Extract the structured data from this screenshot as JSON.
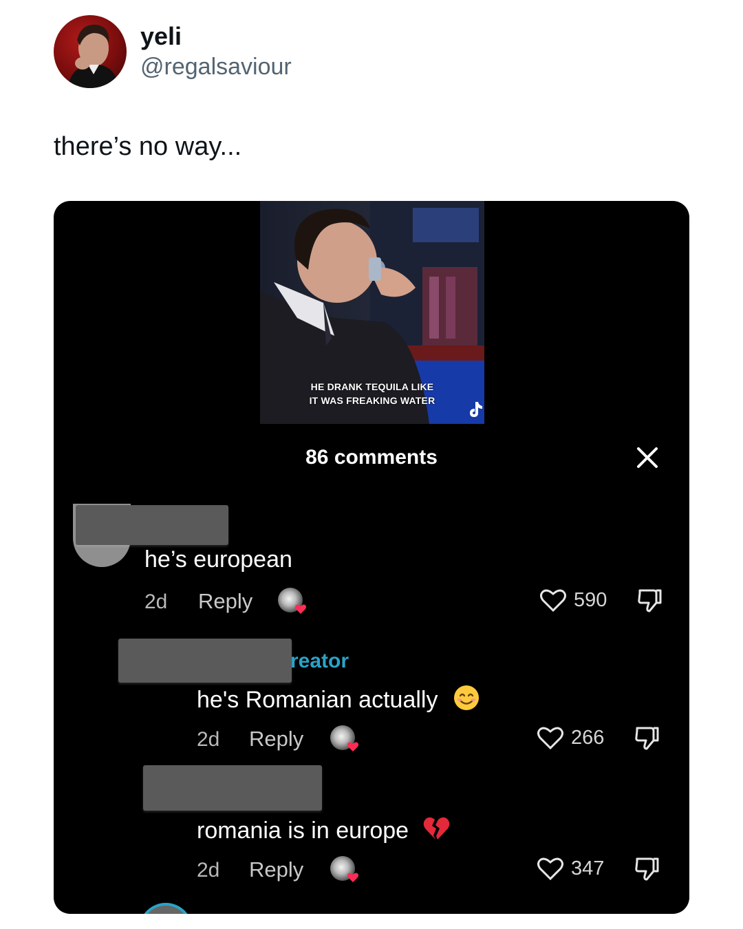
{
  "tweet": {
    "display_name": "yeli",
    "handle": "@regalsaviour",
    "text": "there’s no way..."
  },
  "video": {
    "caption_line1": "HE DRANK TEQUILA LIKE",
    "caption_line2": "IT WAS FREAKING WATER",
    "watermark": "TikTok"
  },
  "comments_panel": {
    "title": "86 comments",
    "close_icon": "close-icon",
    "comments": [
      {
        "text": "he’s european",
        "age": "2d",
        "reply_label": "Reply",
        "likes": "590"
      },
      {
        "creator_label": "reator",
        "text": "he's Romanian actually",
        "emoji": "😊",
        "age": "2d",
        "reply_label": "Reply",
        "likes": "266"
      },
      {
        "text": "romania is in europe",
        "emoji": "💔",
        "age": "2d",
        "reply_label": "Reply",
        "likes": "347"
      }
    ]
  },
  "colors": {
    "card_bg": "#000000",
    "creator_label": "#2aa3c8",
    "handle": "#536471"
  }
}
